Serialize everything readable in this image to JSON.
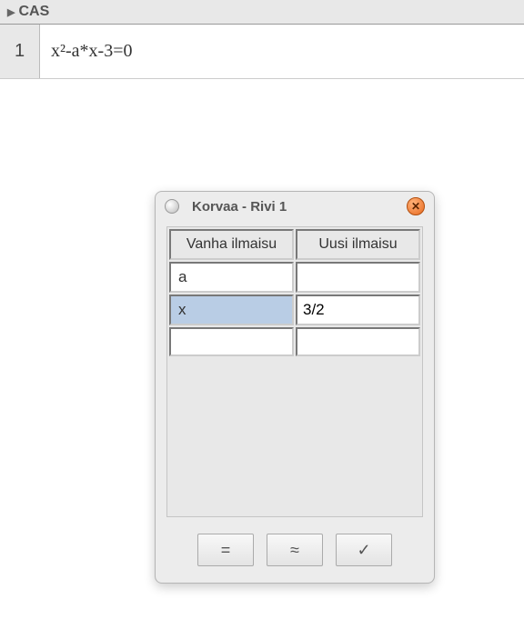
{
  "panel": {
    "title": "CAS"
  },
  "cas": {
    "rows": [
      {
        "number": "1",
        "expression": "x²-a*x-3=0"
      }
    ]
  },
  "dialog": {
    "title": "Korvaa - Rivi 1",
    "headers": {
      "old": "Vanha ilmaisu",
      "new": "Uusi ilmaisu"
    },
    "rows": [
      {
        "old": "a",
        "new": ""
      },
      {
        "old": "x",
        "new": "3/2"
      },
      {
        "old": "",
        "new": ""
      }
    ],
    "buttons": {
      "equals": "=",
      "approx": "≈",
      "check": "✓"
    }
  }
}
